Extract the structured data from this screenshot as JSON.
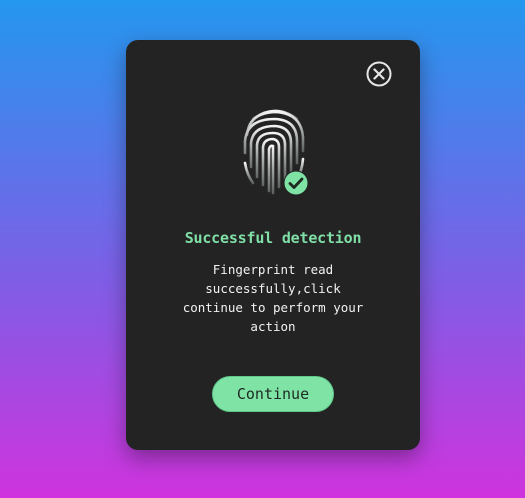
{
  "dialog": {
    "title": "Successful detection",
    "message_lines": [
      "Fingerprint read",
      "successfully,click",
      "continue to perform your",
      "action"
    ],
    "continue_label": "Continue"
  },
  "icons": {
    "close": "close-circle-icon",
    "fingerprint": "fingerprint-icon",
    "check": "check-circle-icon"
  },
  "colors": {
    "accent": "#7fe3a6",
    "title": "#7fdfa6",
    "card_bg": "#232323",
    "background_top": "#2497ee",
    "background_bottom": "#cf33dd"
  }
}
